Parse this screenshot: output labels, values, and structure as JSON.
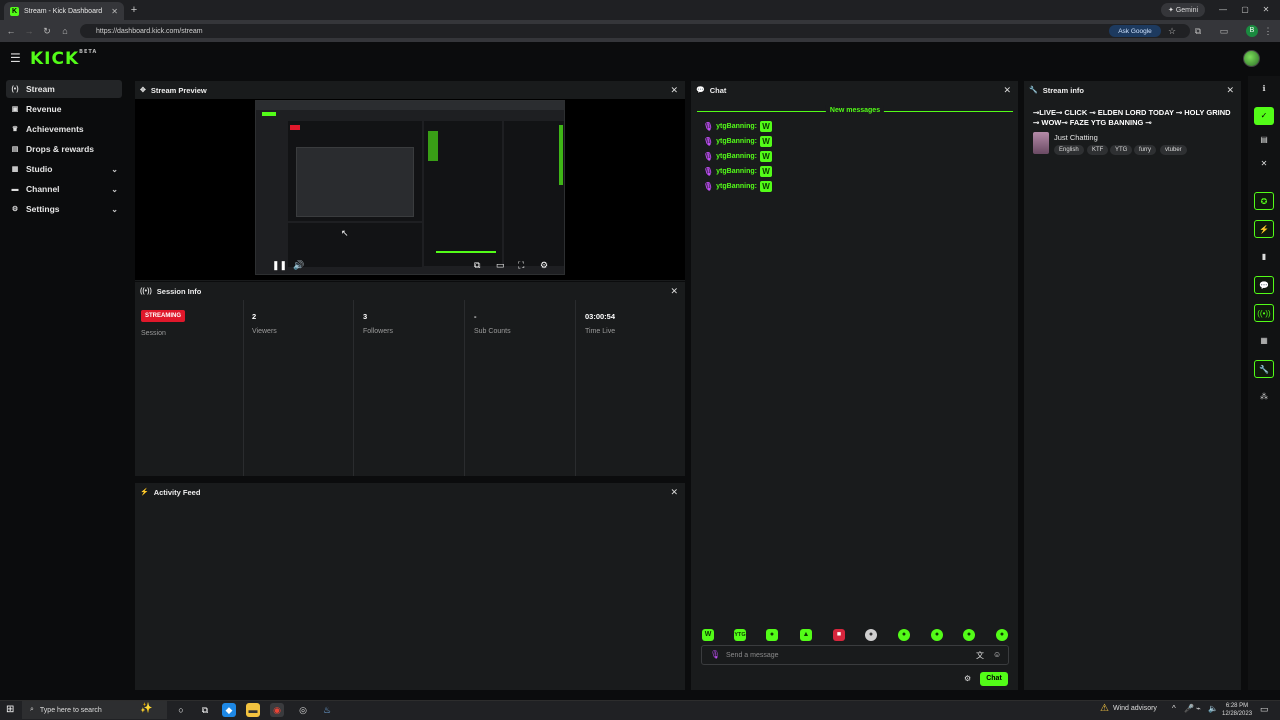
{
  "browser": {
    "tab_title": "Stream - Kick Dashboard",
    "url": "https://dashboard.kick.com/stream",
    "ask_google": "Ask Google",
    "gemini": "Gemini",
    "profile_initial": "B"
  },
  "header": {
    "logo": "KICK",
    "logo_badge": "BETA"
  },
  "sidebar": {
    "items": [
      {
        "label": "Stream",
        "icon": "broadcast-icon"
      },
      {
        "label": "Revenue",
        "icon": "revenue-icon"
      },
      {
        "label": "Achievements",
        "icon": "trophy-icon"
      },
      {
        "label": "Drops & rewards",
        "icon": "gift-icon"
      },
      {
        "label": "Studio",
        "icon": "studio-icon"
      },
      {
        "label": "Channel",
        "icon": "channel-icon"
      },
      {
        "label": "Settings",
        "icon": "gear-icon"
      }
    ]
  },
  "panels": {
    "preview_title": "Stream Preview",
    "session_title": "Session Info",
    "activity_title": "Activity Feed",
    "chat_title": "Chat",
    "streaminfo_title": "Stream info"
  },
  "session": {
    "status_badge": "STREAMING",
    "session_label": "Session",
    "stats": [
      {
        "value": "2",
        "label": "Viewers"
      },
      {
        "value": "3",
        "label": "Followers"
      },
      {
        "value": "-",
        "label": "Sub Counts"
      },
      {
        "value": "03:00:54",
        "label": "Time Live"
      }
    ]
  },
  "chat": {
    "new_messages": "New messages",
    "messages": [
      {
        "user": "ytgBanning:",
        "emote": "W"
      },
      {
        "user": "ytgBanning:",
        "emote": "W"
      },
      {
        "user": "ytgBanning:",
        "emote": "W"
      },
      {
        "user": "ytgBanning:",
        "emote": "W"
      },
      {
        "user": "ytgBanning:",
        "emote": "W"
      }
    ],
    "emotes": [
      "W",
      "YTG",
      "",
      "",
      "",
      "",
      "",
      "",
      "",
      ""
    ],
    "input_placeholder": "Send a message",
    "send_label": "Chat"
  },
  "stream_info": {
    "title": "⊸LIVE⊸ CLICK ⊸ ELDEN LORD TODAY ⊸ HOLY GRIND ⊸ WOW⊸ FAZE YTG BANNING ⊸",
    "category": "Just Chatting",
    "tags": [
      "English",
      "KTF",
      "YTG",
      "furry",
      "vtuber"
    ]
  },
  "taskbar": {
    "search_placeholder": "Type here to search",
    "weather": "Wind advisory",
    "time": "6:28 PM",
    "date": "12/28/2023"
  },
  "colors": {
    "accent": "#53fc18",
    "live": "#e0182b",
    "panel": "#191b1c",
    "background": "#0b0c0d"
  }
}
